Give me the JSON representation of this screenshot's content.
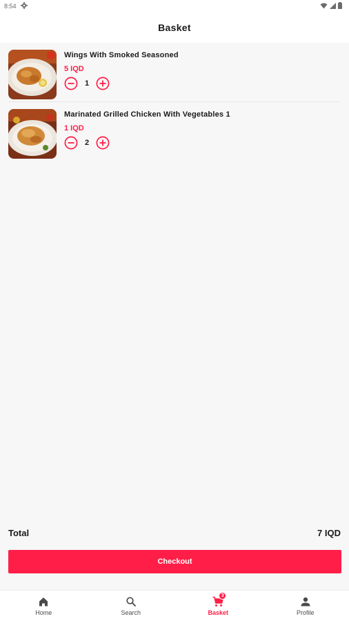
{
  "status_bar": {
    "time": "8:54"
  },
  "app_bar": {
    "title": "Basket"
  },
  "items": [
    {
      "name": "Wings With Smoked Seasoned",
      "price": "5 IQD",
      "quantity": "1"
    },
    {
      "name": "Marinated Grilled Chicken With Vegetables 1",
      "price": "1 IQD",
      "quantity": "2"
    }
  ],
  "summary": {
    "total_label": "Total",
    "total_value": "7 IQD"
  },
  "checkout": {
    "label": "Checkout"
  },
  "nav": {
    "items": [
      {
        "label": "Home",
        "icon": "home-icon"
      },
      {
        "label": "Search",
        "icon": "search-icon"
      },
      {
        "label": "Basket",
        "icon": "cart-icon",
        "badge": "3",
        "active": true
      },
      {
        "label": "Profile",
        "icon": "profile-icon"
      }
    ]
  },
  "colors": {
    "accent": "#ff1e47",
    "background": "#f7f7f7",
    "surface": "#ffffff"
  }
}
